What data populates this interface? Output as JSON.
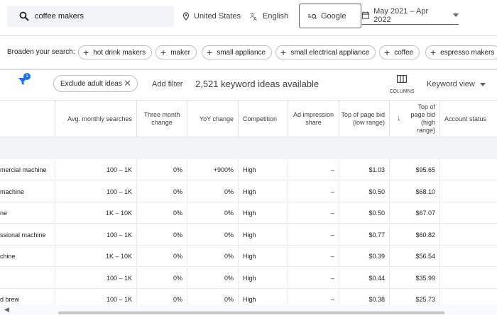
{
  "search": {
    "query": "coffee makers"
  },
  "top": {
    "location": "United States",
    "language": "English",
    "network": "Google",
    "date_range": "May 2021 – Apr 2022"
  },
  "broaden": {
    "label": "Broaden your search:",
    "chips": [
      "hot drink makers",
      "maker",
      "small appliance",
      "small electrical appliance",
      "coffee",
      "espresso makers"
    ]
  },
  "filters": {
    "badge_count": "1",
    "exclude_chip": "Exclude adult ideas",
    "add_filter": "Add filter",
    "ideas_count": "2,521 keyword ideas available",
    "columns_label": "COLUMNS",
    "view": "Keyword view"
  },
  "table": {
    "headers": {
      "avg": "Avg. monthly searches",
      "three_month": "Three month change",
      "yoy": "YoY change",
      "competition": "Competition",
      "impression": "Ad impression share",
      "bid_low": "Top of page bid (low range)",
      "bid_high": "Top of page bid (high range)",
      "status": "Account status"
    },
    "rows": [
      {
        "keyword": "mercial machine",
        "avg": "100 – 1K",
        "three": "0%",
        "yoy": "+900%",
        "comp": "High",
        "imp": "–",
        "low": "$1.03",
        "high": "$95.65"
      },
      {
        "keyword": "machine",
        "avg": "100 – 1K",
        "three": "0%",
        "yoy": "0%",
        "comp": "High",
        "imp": "–",
        "low": "$0.50",
        "high": "$68.10"
      },
      {
        "keyword": "ne",
        "avg": "1K – 10K",
        "three": "0%",
        "yoy": "0%",
        "comp": "High",
        "imp": "–",
        "low": "$0.50",
        "high": "$67.07"
      },
      {
        "keyword": "ssional machine",
        "avg": "100 – 1K",
        "three": "0%",
        "yoy": "0%",
        "comp": "High",
        "imp": "–",
        "low": "$0.77",
        "high": "$60.82"
      },
      {
        "keyword": "chine",
        "avg": "1K – 10K",
        "three": "0%",
        "yoy": "0%",
        "comp": "High",
        "imp": "–",
        "low": "$0.39",
        "high": "$56.54"
      },
      {
        "keyword": "",
        "avg": "100 – 1K",
        "three": "0%",
        "yoy": "0%",
        "comp": "High",
        "imp": "–",
        "low": "$0.44",
        "high": "$35.99"
      },
      {
        "keyword": "d brew",
        "avg": "100 – 1K",
        "three": "0%",
        "yoy": "0%",
        "comp": "High",
        "imp": "–",
        "low": "$0.38",
        "high": "$25.73"
      }
    ]
  },
  "colors": {
    "accent": "#1a73e8",
    "band": "#f1f3f4",
    "border": "#e0e0e0"
  }
}
